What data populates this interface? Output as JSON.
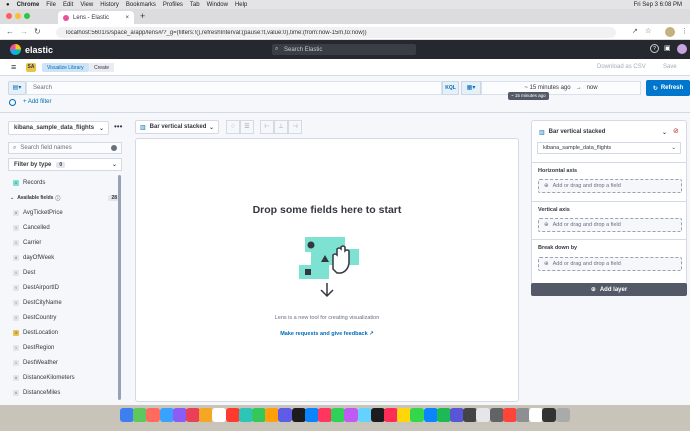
{
  "mac": {
    "apple": "",
    "items": [
      "Chrome",
      "File",
      "Edit",
      "View",
      "History",
      "Bookmarks",
      "Profiles",
      "Tab",
      "Window",
      "Help"
    ],
    "clock": "Fri Sep 3  6:08 PM"
  },
  "browser": {
    "tab_title": "Lens - Elastic",
    "new_tab": "+",
    "url": "localhost:5601/s/space_a/app/lens#/?_g=(filters:!(),refreshInterval:(pause:!t,value:0),time:(from:now-15m,to:now))"
  },
  "kibana": {
    "logo": "elastic",
    "search_placeholder": "Search Elastic",
    "space": "SA",
    "crumbs": [
      "Visualize Library",
      "Create"
    ],
    "download": "Download as CSV",
    "save": "Save"
  },
  "query": {
    "placeholder": "Search",
    "lang": "KQL",
    "time_from": "~ 15 minutes ago",
    "arrow": "→",
    "time_to": "now",
    "refresh": "Refresh",
    "tooltip": "~ 15 minutes ago",
    "add_filter": "+ Add filter"
  },
  "left": {
    "index": "kibana_sample_data_flights",
    "search_placeholder": "Search field names",
    "filter_label": "Filter by type",
    "filter_count": "0",
    "records": "Records",
    "available": "Available fields",
    "available_count": "28",
    "fields": [
      "AvgTicketPrice",
      "Cancelled",
      "Carrier",
      "dayOfWeek",
      "Dest",
      "DestAirportID",
      "DestCityName",
      "DestCountry",
      "DestLocation",
      "DestRegion",
      "DestWeather",
      "DistanceKilometers",
      "DistanceMiles"
    ]
  },
  "toolbar": {
    "chart_type": "Bar vertical stacked"
  },
  "workspace": {
    "title": "Drop some fields here to start",
    "desc": "Lens is a new tool for creating visualization",
    "feedback": "Make requests and give feedback"
  },
  "right": {
    "chart_type": "Bar vertical stacked",
    "index": "kibana_sample_data_flights",
    "h_axis": "Horizontal axis",
    "v_axis": "Vertical axis",
    "breakdown": "Break down by",
    "drop": "Add or drag and drop a field",
    "add_layer": "Add layer"
  }
}
